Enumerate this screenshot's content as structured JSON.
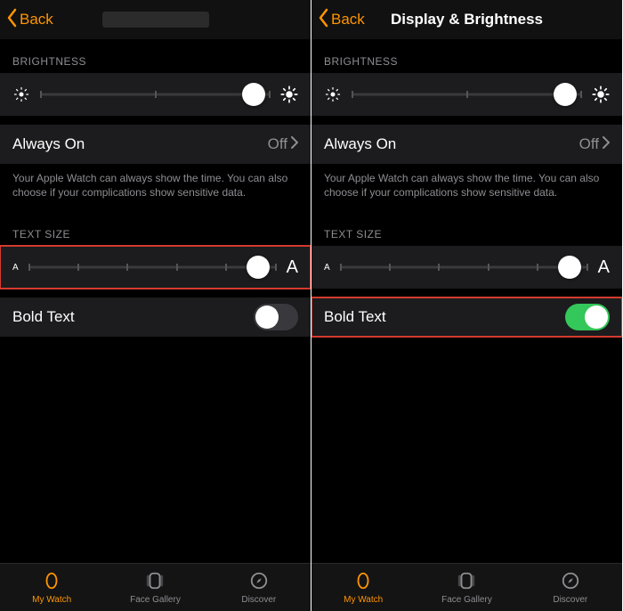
{
  "left": {
    "nav": {
      "back": "Back",
      "title": ""
    },
    "brightness_header": "BRIGHTNESS",
    "always_on": {
      "label": "Always On",
      "value": "Off"
    },
    "always_on_desc": "Your Apple Watch can always show the time. You can also choose if your complications show sensitive data.",
    "text_size_header": "TEXT SIZE",
    "text_size_left": "A",
    "text_size_right": "A",
    "bold_text": {
      "label": "Bold Text",
      "on": false
    },
    "highlight_target": "text-size"
  },
  "right": {
    "nav": {
      "back": "Back",
      "title": "Display & Brightness"
    },
    "brightness_header": "BRIGHTNESS",
    "always_on": {
      "label": "Always On",
      "value": "Off"
    },
    "always_on_desc": "Your Apple Watch can always show the time. You can also choose if your complications show sensitive data.",
    "text_size_header": "TEXT SIZE",
    "text_size_left": "A",
    "text_size_right": "A",
    "bold_text": {
      "label": "Bold Text",
      "on": true
    },
    "highlight_target": "bold-text"
  },
  "sliders": {
    "brightness": {
      "value": 0.93,
      "ticks": [
        0,
        0.5,
        1
      ]
    },
    "text_size": {
      "value": 0.93,
      "ticks": [
        0,
        0.2,
        0.4,
        0.6,
        0.8,
        1
      ]
    }
  },
  "tabbar": {
    "my_watch": "My Watch",
    "face_gallery": "Face Gallery",
    "discover": "Discover"
  }
}
